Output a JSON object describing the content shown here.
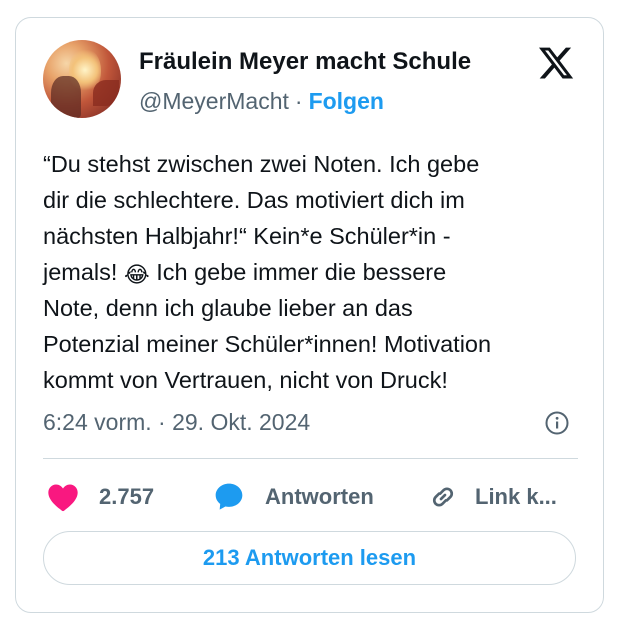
{
  "author": {
    "display_name": "Fräulein Meyer macht Schule",
    "handle": "@MeyerMacht",
    "separator": "·",
    "follow_label": "Folgen"
  },
  "tweet": {
    "lines": [
      "“Du stehst zwischen zwei Noten. Ich gebe",
      "dir die schlechtere. Das motiviert dich im",
      "nächsten Halbjahr!“ Kein*e Schüler*in -",
      "jemals!",
      "Ich gebe immer die bessere",
      "Note, denn ich glaube lieber an das",
      "Potenzial meiner Schüler*innen! Motivation",
      "kommt von Vertrauen, nicht von Druck!"
    ],
    "emoji": "😂",
    "timestamp": "6:24 vorm. · 29. Okt. 2024"
  },
  "actions": {
    "like_count": "2.757",
    "reply_label": "Antworten",
    "link_label": "Link k..."
  },
  "read_replies_label": "213 Antworten lesen",
  "icons": {
    "logo": "x-logo-icon",
    "info": "info-icon",
    "like": "heart-icon",
    "reply": "speech-bubble-icon",
    "link": "link-icon"
  },
  "colors": {
    "accent": "#1d9bf0",
    "heart": "#f91880",
    "secondary_text": "#536471",
    "border": "#cfd9de"
  }
}
